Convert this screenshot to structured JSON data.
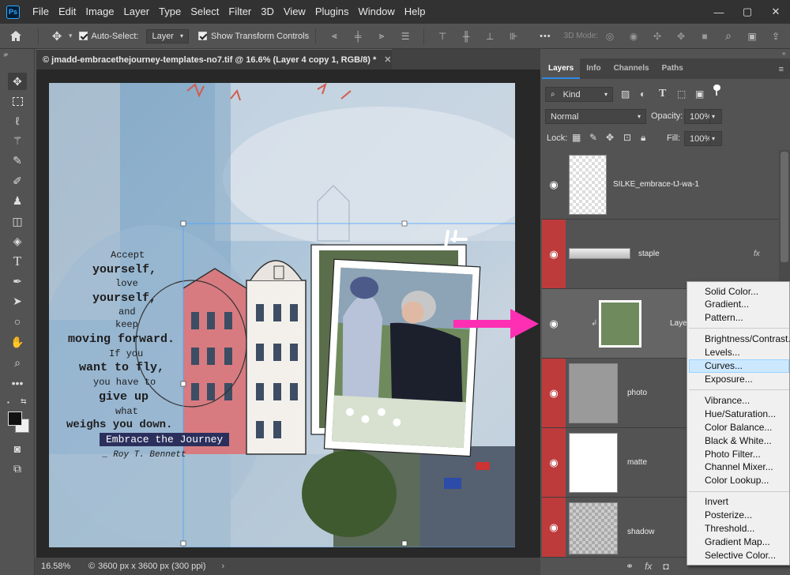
{
  "app": {
    "logo": "Ps"
  },
  "menu": [
    "File",
    "Edit",
    "Image",
    "Layer",
    "Type",
    "Select",
    "Filter",
    "3D",
    "View",
    "Plugins",
    "Window",
    "Help"
  ],
  "window_controls": {
    "minimize": "—",
    "restore": "▢",
    "close": "✕"
  },
  "options": {
    "auto_select_label": "Auto-Select:",
    "auto_select_value": "Layer",
    "show_transform_label": "Show Transform Controls",
    "more": "•••",
    "mode_label": "3D Mode:"
  },
  "document": {
    "tab_title": "© jmadd-embracethejourney-templates-no7.tif @ 16.6% (Layer 4 copy 1, RGB/8) *",
    "zoom": "16.58%",
    "doc_info": "3600 px x 3600 px (300 ppi)"
  },
  "canvas_text": {
    "quote_lines": [
      "Accept",
      "yourself,",
      "love",
      "yourself,",
      "and",
      "keep",
      "moving forward.",
      "If you",
      "want to fly,",
      "you have to",
      "give up",
      "what",
      "weighs you down."
    ],
    "label": "Embrace the Journey",
    "author": "_ Roy T. Bennett"
  },
  "panel": {
    "tabs": [
      "Layers",
      "Info",
      "Channels",
      "Paths"
    ],
    "kind_label": "Kind",
    "blend_mode": "Normal",
    "opacity_label": "Opacity:",
    "opacity_value": "100%",
    "lock_label": "Lock:",
    "fill_label": "Fill:",
    "fill_value": "100%",
    "layers": [
      {
        "name": "SILKE_embrace-tJ-wa-1"
      },
      {
        "name": "staple",
        "fx": "fx"
      },
      {
        "name": "Layer"
      },
      {
        "name": "photo"
      },
      {
        "name": "matte"
      },
      {
        "name": "shadow"
      }
    ]
  },
  "context_menu": {
    "group1": [
      "Solid Color...",
      "Gradient...",
      "Pattern..."
    ],
    "group2": [
      "Brightness/Contrast...",
      "Levels...",
      "Curves...",
      "Exposure..."
    ],
    "group3": [
      "Vibrance...",
      "Hue/Saturation...",
      "Color Balance...",
      "Black & White...",
      "Photo Filter...",
      "Channel Mixer...",
      "Color Lookup..."
    ],
    "group4": [
      "Invert",
      "Posterize...",
      "Threshold...",
      "Gradient Map...",
      "Selective Color..."
    ],
    "highlighted": "Curves..."
  },
  "colors": {
    "arrow": "#ff2fb4",
    "highlight": "#cce8ff",
    "eye_red": "#bd3b3b"
  }
}
